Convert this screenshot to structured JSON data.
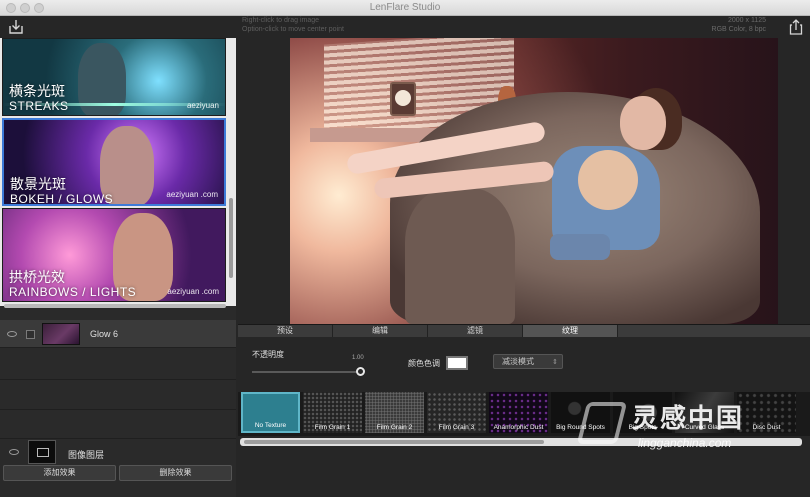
{
  "app": {
    "title": "LenFlare Studio"
  },
  "toolbar": {
    "hint_line1": "Right-click to drag image",
    "hint_line2": "Option-click to move center point",
    "dimensions": "2000 x 1125",
    "color_mode": "RGB Color, 8 bpc"
  },
  "presets": [
    {
      "zh": "横条光斑",
      "en": "STREAKS",
      "watermark": "aeziyuan"
    },
    {
      "zh": "散景光斑",
      "en": "BOKEH / GLOWS",
      "watermark": "aeziyuan .com"
    },
    {
      "zh": "拱桥光效",
      "en": "RAINBOWS / LIGHTS",
      "watermark": "aeziyuan .com"
    }
  ],
  "layers": {
    "effect_layer_name": "Glow 6",
    "image_layer_name": "图像图层",
    "add_effect_button": "添加效果",
    "delete_effect_button": "删除效果"
  },
  "tabs": [
    {
      "label": "预设",
      "active": false
    },
    {
      "label": "编辑",
      "active": false
    },
    {
      "label": "滤镜",
      "active": false
    },
    {
      "label": "纹理",
      "active": true
    }
  ],
  "texture_settings": {
    "opacity_label": "不透明度",
    "opacity_value": "1.00",
    "opacity_fraction": 1.0,
    "color_label": "颜色色调",
    "color_value": "#ffffff",
    "blend_mode": "减淡模式"
  },
  "textures": [
    {
      "name": "No Texture",
      "selected": true
    },
    {
      "name": "Film Grain 1",
      "selected": false
    },
    {
      "name": "Film Grain 2",
      "selected": false
    },
    {
      "name": "Film Grain 3",
      "selected": false
    },
    {
      "name": "Anamorphic Dust",
      "selected": false
    },
    {
      "name": "Big Round Spots",
      "selected": false
    },
    {
      "name": "Big Spots",
      "selected": false
    },
    {
      "name": "Curved Glass",
      "selected": false
    },
    {
      "name": "Disc Dust",
      "selected": false
    }
  ],
  "watermark": {
    "cn": "灵感中国",
    "url": "lingganchina.com"
  }
}
